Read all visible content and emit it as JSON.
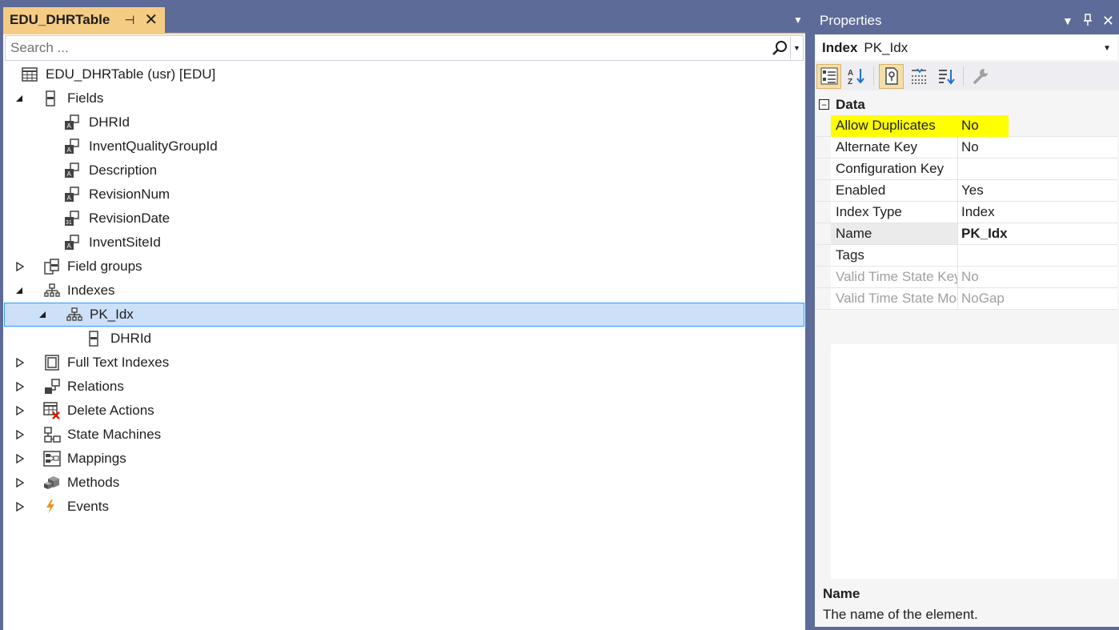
{
  "document_tab": {
    "title": "EDU_DHRTable",
    "pin_icon": "pin-icon",
    "close_icon": "close-icon"
  },
  "search": {
    "placeholder": "Search ...",
    "value": ""
  },
  "tree": {
    "root": "EDU_DHRTable (usr) [EDU]",
    "fields_label": "Fields",
    "fields": [
      "DHRId",
      "InventQualityGroupId",
      "Description",
      "RevisionNum",
      "RevisionDate",
      "InventSiteId"
    ],
    "field_groups": "Field groups",
    "indexes": "Indexes",
    "index_pk": "PK_Idx",
    "index_field": "DHRId",
    "full_text_indexes": "Full Text Indexes",
    "relations": "Relations",
    "delete_actions": "Delete Actions",
    "state_machines": "State Machines",
    "mappings": "Mappings",
    "methods": "Methods",
    "events": "Events"
  },
  "properties": {
    "title": "Properties",
    "object_type": "Index",
    "object_name": "PK_Idx",
    "category": "Data",
    "rows": [
      {
        "name": "Allow Duplicates",
        "value": "No"
      },
      {
        "name": "Alternate Key",
        "value": "No"
      },
      {
        "name": "Configuration Key",
        "value": ""
      },
      {
        "name": "Enabled",
        "value": "Yes"
      },
      {
        "name": "Index Type",
        "value": "Index"
      },
      {
        "name": "Name",
        "value": "PK_Idx"
      },
      {
        "name": "Tags",
        "value": ""
      },
      {
        "name": "Valid Time State Key",
        "value": "No"
      },
      {
        "name": "Valid Time State Mode",
        "value": "NoGap"
      }
    ],
    "description_title": "Name",
    "description_text": "The name of the element."
  },
  "colors": {
    "chrome": "#5d6b99",
    "active_tab": "#f5cc84",
    "selection": "#cce0f7",
    "highlight": "#ffff00"
  }
}
